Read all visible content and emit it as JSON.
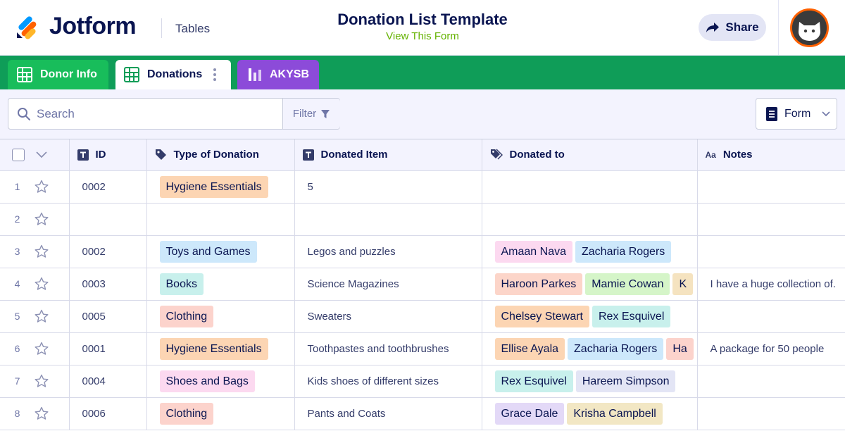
{
  "header": {
    "logo_text": "Jotform",
    "product": "Tables",
    "title": "Donation List Template",
    "view_form": "View This Form",
    "share_label": "Share"
  },
  "tabs": [
    {
      "label": "Donor Info",
      "icon": "grid-icon",
      "color": "#18bd5b",
      "active": false
    },
    {
      "label": "Donations",
      "icon": "grid-icon",
      "color": "#ffffff",
      "active": true
    },
    {
      "label": "AKYSB",
      "icon": "report-icon",
      "color": "#8c4bd9",
      "active": false
    }
  ],
  "toolbar": {
    "search_placeholder": "Search",
    "filter_label": "Filter",
    "form_label": "Form"
  },
  "table": {
    "columns": [
      {
        "label": "ID",
        "icon": "text-type-icon"
      },
      {
        "label": "Type of Donation",
        "icon": "tag-icon"
      },
      {
        "label": "Donated Item",
        "icon": "text-type-icon"
      },
      {
        "label": "Donated to",
        "icon": "tags-icon"
      },
      {
        "label": "Notes",
        "icon": "Aa"
      }
    ],
    "rows": [
      {
        "num": "1",
        "id": "0002",
        "type": {
          "label": "Hygiene Essentials",
          "color": "#fcd5b3"
        },
        "item": "5",
        "donated_to": [],
        "notes": ""
      },
      {
        "num": "2",
        "id": "",
        "type": null,
        "item": "",
        "donated_to": [],
        "notes": ""
      },
      {
        "num": "3",
        "id": "0002",
        "type": {
          "label": "Toys and Games",
          "color": "#cde8fb"
        },
        "item": "Legos and puzzles",
        "donated_to": [
          {
            "label": "Amaan Nava",
            "color": "#fcd9f0"
          },
          {
            "label": "Zacharia Rogers",
            "color": "#cde8fb"
          }
        ],
        "notes": ""
      },
      {
        "num": "4",
        "id": "0003",
        "type": {
          "label": "Books",
          "color": "#c8f0ec"
        },
        "item": "Science Magazines",
        "donated_to": [
          {
            "label": "Haroon Parkes",
            "color": "#fcd5c9"
          },
          {
            "label": "Mamie Cowan",
            "color": "#d5f5c8"
          },
          {
            "label": "K",
            "color": "#f5e3c0"
          }
        ],
        "notes": "I have a huge collection of."
      },
      {
        "num": "5",
        "id": "0005",
        "type": {
          "label": "Clothing",
          "color": "#fcd3cc"
        },
        "item": "Sweaters",
        "donated_to": [
          {
            "label": "Chelsey Stewart",
            "color": "#fcd5b3"
          },
          {
            "label": "Rex Esquivel",
            "color": "#c8f0ec"
          }
        ],
        "notes": ""
      },
      {
        "num": "6",
        "id": "0001",
        "type": {
          "label": "Hygiene Essentials",
          "color": "#fcd5b3"
        },
        "item": "Toothpastes and toothbrushes",
        "donated_to": [
          {
            "label": "Ellise Ayala",
            "color": "#fcd5b3"
          },
          {
            "label": "Zacharia Rogers",
            "color": "#cde8fb"
          },
          {
            "label": "Ha",
            "color": "#fcd3cc"
          }
        ],
        "notes": "A package for 50 people"
      },
      {
        "num": "7",
        "id": "0004",
        "type": {
          "label": "Shoes and Bags",
          "color": "#fcd9f0"
        },
        "item": "Kids shoes of different sizes",
        "donated_to": [
          {
            "label": "Rex Esquivel",
            "color": "#c8f0ec"
          },
          {
            "label": "Hareem Simpson",
            "color": "#e3e5f5"
          }
        ],
        "notes": ""
      },
      {
        "num": "8",
        "id": "0006",
        "type": {
          "label": "Clothing",
          "color": "#fcd3cc"
        },
        "item": "Pants and Coats",
        "donated_to": [
          {
            "label": "Grace Dale",
            "color": "#e3d9f7"
          },
          {
            "label": "Krisha Campbell",
            "color": "#f2e7c4"
          }
        ],
        "notes": ""
      }
    ]
  }
}
